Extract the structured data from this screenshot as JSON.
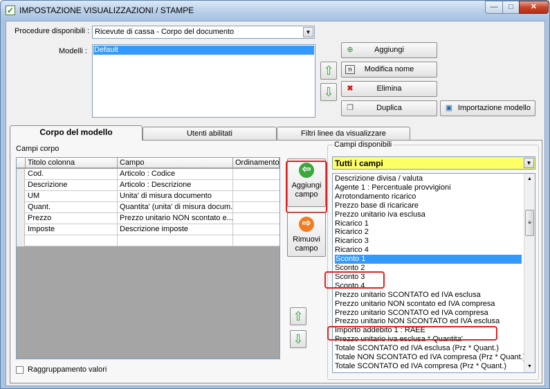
{
  "window": {
    "title": "IMPOSTAZIONE VISUALIZZAZIONI / STAMPE",
    "minimize": "—",
    "maximize": "□",
    "close": "✕"
  },
  "procedure": {
    "label": "Procedure disponibili :",
    "value": "Ricevute di cassa - Corpo del documento",
    "arrow": "▼"
  },
  "modelli": {
    "label": "Modelli :",
    "items": [
      "Default"
    ]
  },
  "actions": {
    "aggiungi": "Aggiungi",
    "modifica": "Modifica nome",
    "elimina": "Elimina",
    "duplica": "Duplica",
    "importazione": "Importazione modello",
    "icons": {
      "aggiungi": "add-icon",
      "modifica": "rename-icon",
      "elimina": "delete-icon",
      "duplica": "copy-icon",
      "importazione": "import-icon"
    }
  },
  "tabs": [
    "Corpo del modello",
    "Utenti abilitati",
    "Filtri linee da visualizzare"
  ],
  "corpo": {
    "group_label": "Campi corpo",
    "columns": [
      "Titolo colonna",
      "Campo",
      "Ordinamento"
    ],
    "rows": [
      {
        "titolo": "Cod.",
        "campo": "Articolo : Codice",
        "ordinamento": ""
      },
      {
        "titolo": "Descrizione",
        "campo": "Articolo : Descrizione",
        "ordinamento": ""
      },
      {
        "titolo": "UM",
        "campo": "Unita' di misura documento",
        "ordinamento": ""
      },
      {
        "titolo": "Quant.",
        "campo": "Quantita' (unita' di misura docum...",
        "ordinamento": ""
      },
      {
        "titolo": "Prezzo",
        "campo": "Prezzo unitario NON scontato e...",
        "ordinamento": ""
      },
      {
        "titolo": "Imposte",
        "campo": "Descrizione imposte",
        "ordinamento": ""
      },
      {
        "titolo": "",
        "campo": "",
        "ordinamento": ""
      }
    ]
  },
  "middle": {
    "aggiungi_campo": "Aggiungi campo",
    "rimuovi_campo": "Rimuovi campo"
  },
  "raggruppamento": {
    "label": "Raggruppamento valori",
    "checked": false
  },
  "disponibili": {
    "group_label": "Campi disponibili",
    "filter_value": "Tutti i campi",
    "selected_index": 9,
    "items": [
      "Descrizione divisa / valuta",
      "Agente 1 : Percentuale provvigioni",
      "Arrotondamento ricarico",
      "Prezzo base di ricaricare",
      "Prezzo unitario iva esclusa",
      "Ricarico 1",
      "Ricarico 2",
      "Ricarico 3",
      "Ricarico 4",
      "Sconto 1",
      "Sconto 2",
      "Sconto 3",
      "Sconto 4",
      "Prezzo unitario SCONTATO ed IVA esclusa",
      "Prezzo unitario NON scontato ed IVA compresa",
      "Prezzo unitario SCONTATO ed IVA compresa",
      "Prezzo unitario NON SCONTATO ed IVA esclusa",
      "Importo addebito 1 : RAEE",
      "Prezzo unitario iva esclusa * Quantita'",
      "Totale SCONTATO ed IVA esclusa (Prz * Quant.)",
      "Totale NON SCONTATO ed IVA compresa (Prz * Quant.)",
      "Totale SCONTATO ed IVA compresa (Prz * Quant.)"
    ]
  },
  "colors": {
    "accent": "#3399ff",
    "highlight": "#e31e1e",
    "filter_bg": "#ffff66"
  }
}
